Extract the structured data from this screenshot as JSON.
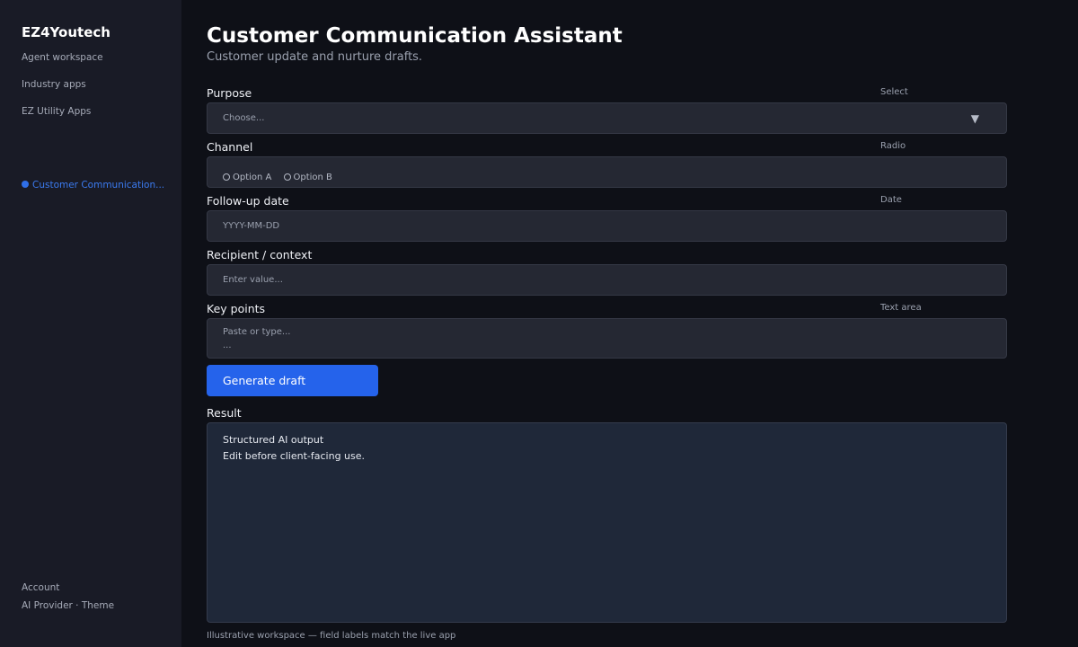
{
  "sidebar": {
    "brand": "EZ4Youtech",
    "items": [
      {
        "label": "Agent workspace"
      },
      {
        "label": "Industry apps"
      },
      {
        "label": "EZ Utility Apps"
      }
    ],
    "active_item": "Customer Communication...",
    "footer": {
      "account": "Account",
      "provider_theme": "AI Provider · Theme"
    }
  },
  "header": {
    "title": "Customer Communication Assistant",
    "subtitle": "Customer update and nurture drafts."
  },
  "form": {
    "purpose": {
      "label": "Purpose",
      "type": "Select",
      "value": "Choose..."
    },
    "channel": {
      "label": "Channel",
      "type": "Radio",
      "options": [
        "Option A",
        "Option B"
      ]
    },
    "followup": {
      "label": "Follow-up date",
      "type": "Date",
      "placeholder": "YYYY-MM-DD"
    },
    "recipient": {
      "label": "Recipient / context",
      "placeholder": "Enter value..."
    },
    "keypoints": {
      "label": "Key points",
      "type": "Text area",
      "placeholder_line1": "Paste or type...",
      "placeholder_line2": "..."
    }
  },
  "actions": {
    "generate_label": "Generate draft"
  },
  "result": {
    "label": "Result",
    "line1": "Structured AI output",
    "line2": "Edit before client-facing use."
  },
  "footer_note": "Illustrative workspace — field labels match the live app",
  "colors": {
    "accent": "#2563eb",
    "active_nav": "#3b7bf0",
    "background": "#0e1017",
    "sidebar": "#191b26"
  }
}
